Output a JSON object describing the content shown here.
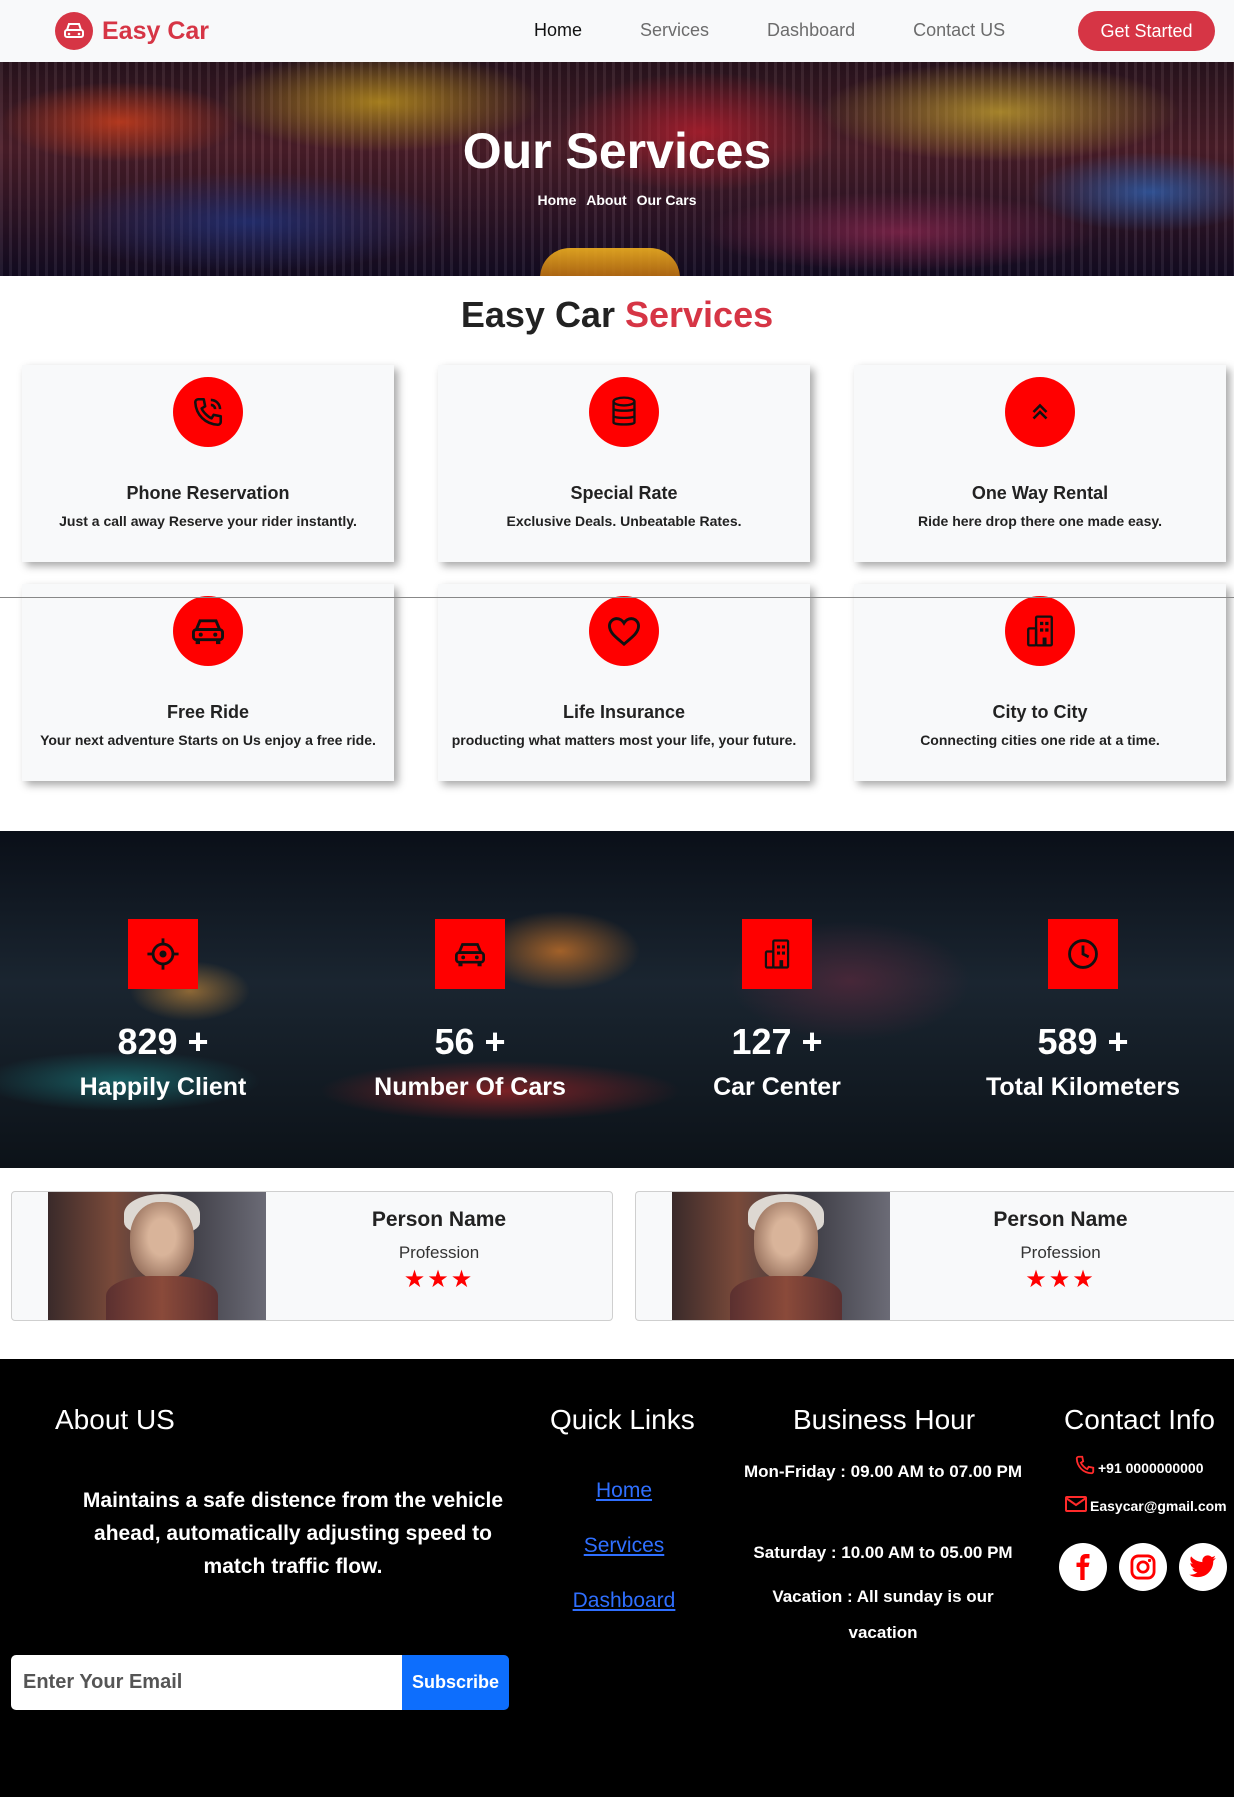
{
  "brand": {
    "name": "Easy Car",
    "color": "#d63545"
  },
  "nav": {
    "links": [
      "Home",
      "Services",
      "Dashboard",
      "Contact US"
    ],
    "active": "Home",
    "cta": "Get Started"
  },
  "hero": {
    "title": "Our Services",
    "breadcrumb": [
      "Home",
      "About",
      "Our Cars"
    ]
  },
  "services": {
    "title_prefix": "Easy Car",
    "title_accent": "Services",
    "items": [
      {
        "icon": "phone-icon",
        "title": "Phone Reservation",
        "desc": "Just a call away Reserve your rider instantly."
      },
      {
        "icon": "database-icon",
        "title": "Special Rate",
        "desc": "Exclusive Deals. Unbeatable Rates."
      },
      {
        "icon": "double-chevron-up-icon",
        "title": "One Way Rental",
        "desc": "Ride here drop there one made easy."
      },
      {
        "icon": "car-icon",
        "title": "Free Ride",
        "desc": "Your next adventure Starts on Us enjoy a free ride."
      },
      {
        "icon": "heart-icon",
        "title": "Life Insurance",
        "desc": "producting what matters most your life, your future."
      },
      {
        "icon": "building-icon",
        "title": "City to City",
        "desc": "Connecting cities one ride at a time."
      }
    ]
  },
  "stats": [
    {
      "icon": "crosshair-icon",
      "value": "829 +",
      "label": "Happily Client"
    },
    {
      "icon": "car-icon",
      "value": "56 +",
      "label": "Number Of Cars"
    },
    {
      "icon": "building-icon",
      "value": "127 +",
      "label": "Car Center"
    },
    {
      "icon": "clock-icon",
      "value": "589 +",
      "label": "Total Kilometers"
    }
  ],
  "testimonials": [
    {
      "name": "Person Name",
      "profession": "Profession",
      "stars": "★★★",
      "rating": 3
    },
    {
      "name": "Person Name",
      "profession": "Profession",
      "stars": "★★★",
      "rating": 3
    }
  ],
  "footer": {
    "about_title": "About US",
    "about_text": "Maintains a safe distence from the vehicle ahead, automatically adjusting speed to match traffic flow.",
    "email_placeholder": "Enter Your Email",
    "subscribe": "Subscribe",
    "quick_title": "Quick Links",
    "quick_links": [
      "Home",
      "Services",
      "Dashboard"
    ],
    "hours_title": "Business Hour",
    "hours": [
      "Mon-Friday : 09.00 AM to 07.00 PM",
      "Saturday : 10.00 AM to 05.00 PM",
      "Vacation : All sunday is our vacation"
    ],
    "contact_title": "Contact Info",
    "phone": "+91 0000000000",
    "email": "Easycar@gmail.com",
    "social": [
      "facebook-icon",
      "instagram-icon",
      "twitter-icon"
    ]
  },
  "colors": {
    "accent_red": "#ff0000",
    "brand_red": "#d63545",
    "link_blue": "#2f6fff",
    "subscribe_blue": "#0d6efd"
  }
}
